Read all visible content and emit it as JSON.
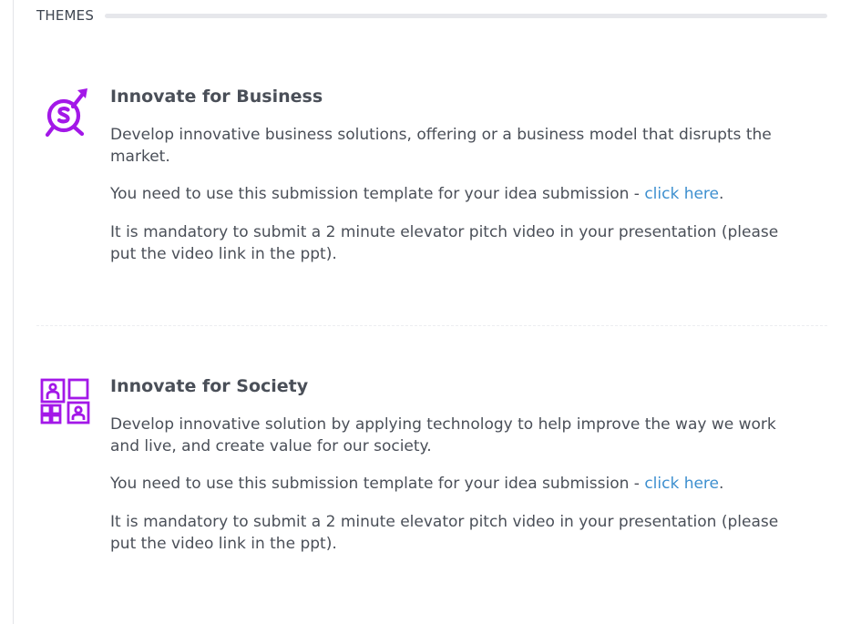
{
  "section": {
    "title": "THEMES"
  },
  "themes": [
    {
      "icon": "business-target-icon",
      "title": "Innovate for Business",
      "description": "Develop innovative business solutions, offering or a business model that disrupts the market.",
      "template_prefix": "You need to use this submission template for your idea submission - ",
      "template_link": "click here",
      "template_suffix": ".",
      "video_note": "It is mandatory to submit a 2 minute elevator pitch video in your presentation (please put the video link in the ppt)."
    },
    {
      "icon": "society-grid-icon",
      "title": "Innovate for Society",
      "description": "Develop innovative solution by applying technology to help improve the way we work and live, and create value for our society.",
      "template_prefix": "You need to use this submission template for your idea submission - ",
      "template_link": "click here",
      "template_suffix": ".",
      "video_note": "It is mandatory to submit a 2 minute elevator pitch video in your presentation (please put the video link in the ppt)."
    }
  ],
  "colors": {
    "icon_accent": "#a318e8",
    "link": "#3d8fcf",
    "text": "#4a4f58"
  }
}
